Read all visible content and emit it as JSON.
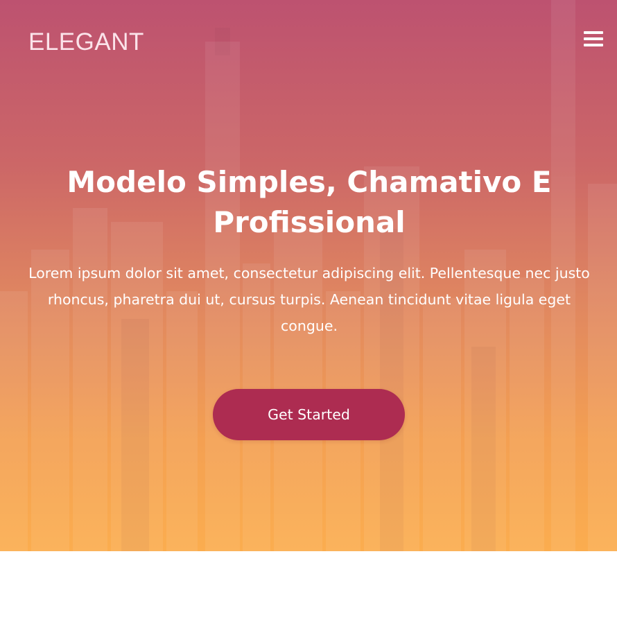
{
  "brand": {
    "name": "ELEGANT"
  },
  "navbar": {
    "menu_icon": "hamburger-menu-icon"
  },
  "hero": {
    "title": "Modelo Simples, Chamativo E Profissional",
    "text": "Lorem ipsum dolor sit amet, consectetur adipiscing elit. Pellentesque nec justo rhoncus, pharetra dui ut, cursus turpis. Aenean tincidunt vitae ligula eget congue.",
    "cta_label": "Get Started",
    "background_image": "city-skyline",
    "colors": {
      "gradient_top": "#bd5270",
      "gradient_bottom": "#fbad4f",
      "button": "#ad2c51",
      "text": "#ffffff"
    }
  }
}
